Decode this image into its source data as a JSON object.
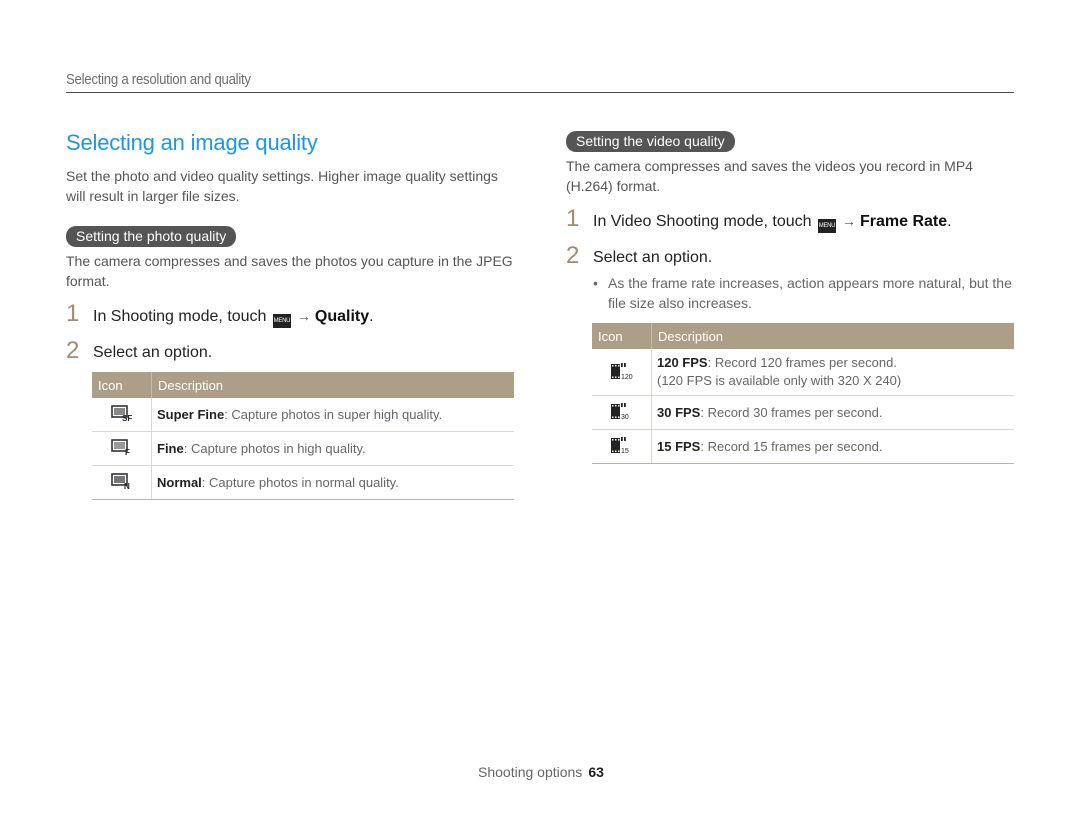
{
  "header": {
    "breadcrumb": "Selecting a resolution and quality"
  },
  "left": {
    "title": "Selecting an image quality",
    "intro": "Set the photo and video quality settings. Higher image quality settings will result in larger file sizes.",
    "section_label": "Setting the photo quality",
    "section_text": "The camera compresses and saves the photos you capture in the JPEG format.",
    "steps": [
      {
        "num": "1",
        "pre": "In Shooting mode, touch",
        "menu_icon": "MENU",
        "arrow": "→",
        "target": "Quality",
        "post": "."
      },
      {
        "num": "2",
        "text": "Select an option."
      }
    ],
    "table": {
      "headers": [
        "Icon",
        "Description"
      ],
      "rows": [
        {
          "icon": "super-fine-quality-icon",
          "name": "Super Fine",
          "desc": ": Capture photos in super high quality."
        },
        {
          "icon": "fine-quality-icon",
          "name": "Fine",
          "desc": ": Capture photos in high quality."
        },
        {
          "icon": "normal-quality-icon",
          "name": "Normal",
          "desc": ": Capture photos in normal quality."
        }
      ]
    }
  },
  "right": {
    "section_label": "Setting the video quality",
    "section_text": "The camera compresses and saves the videos you record in MP4 (H.264) format.",
    "steps": [
      {
        "num": "1",
        "pre": "In Video Shooting mode, touch",
        "menu_icon": "MENU",
        "arrow": "→",
        "target": "Frame Rate",
        "post": "."
      },
      {
        "num": "2",
        "text": "Select an option."
      }
    ],
    "bullet": "As the frame rate increases, action appears more natural, but the file size also increases.",
    "table": {
      "headers": [
        "Icon",
        "Description"
      ],
      "rows": [
        {
          "icon_label": "120",
          "name": "120 FPS",
          "desc": ": Record 120 frames per second.",
          "note": "(120 FPS is available only with 320 X 240)"
        },
        {
          "icon_label": "30",
          "name": "30 FPS",
          "desc": ": Record 30 frames per second."
        },
        {
          "icon_label": "15",
          "name": "15 FPS",
          "desc": ": Record 15 frames per second."
        }
      ]
    }
  },
  "footer": {
    "section": "Shooting options",
    "page": "63"
  },
  "colors": {
    "title": "#1e95e8",
    "table_header": "#ad9e88",
    "step_number": "#a58a6e",
    "pill": "#555555"
  }
}
